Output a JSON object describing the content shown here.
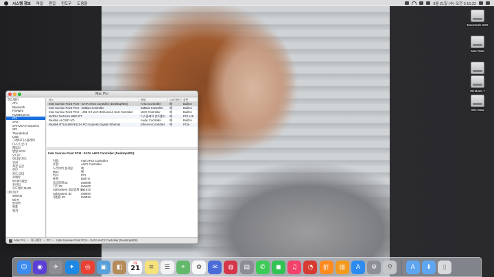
{
  "menubar": {
    "app_name": "시스템 정보",
    "menus": [
      "파일",
      "편집",
      "윈도우",
      "도움말"
    ],
    "clock": "9월 21일 (수) 오전 3:16:22"
  },
  "desktop": {
    "drives": [
      "Macintosh SSD",
      "Mac Data",
      "Mac Data",
      "Windows 7",
      "Win Data"
    ]
  },
  "window": {
    "title": "Mac Pro",
    "sidebar": [
      {
        "label": "하드웨어",
        "type": "group"
      },
      {
        "label": "ATA",
        "type": "child"
      },
      {
        "label": "Bluetooth",
        "type": "child"
      },
      {
        "label": "FireWire",
        "type": "child"
      },
      {
        "label": "NVMExpress",
        "type": "child"
      },
      {
        "label": "PCI",
        "type": "child",
        "selected": true
      },
      {
        "label": "SAS",
        "type": "child"
      },
      {
        "label": "SATA/SATA Express",
        "type": "child"
      },
      {
        "label": "SPI",
        "type": "child"
      },
      {
        "label": "Thunderbolt",
        "type": "child"
      },
      {
        "label": "USB",
        "type": "child"
      },
      {
        "label": "그래픽/디스플레이",
        "type": "child"
      },
      {
        "label": "디스크 굽기",
        "type": "child"
      },
      {
        "label": "메모리",
        "type": "child"
      },
      {
        "label": "병렬 SCSI",
        "type": "child"
      },
      {
        "label": "오디오",
        "type": "child"
      },
      {
        "label": "이더넷 카드",
        "type": "child"
      },
      {
        "label": "전원",
        "type": "child"
      },
      {
        "label": "저장 공간",
        "type": "child"
      },
      {
        "label": "진단",
        "type": "child"
      },
      {
        "label": "카드 리더",
        "type": "child"
      },
      {
        "label": "카메라",
        "type": "child"
      },
      {
        "label": "파이버 채널",
        "type": "child"
      },
      {
        "label": "프린터",
        "type": "child"
      },
      {
        "label": "하드웨어 RAID",
        "type": "child"
      },
      {
        "label": "네트워크",
        "type": "group"
      },
      {
        "label": "WWAN",
        "type": "child"
      },
      {
        "label": "Wi-Fi",
        "type": "child"
      },
      {
        "label": "방화벽",
        "type": "child"
      },
      {
        "label": "볼륨",
        "type": "child"
      },
      {
        "label": "위치",
        "type": "child"
      }
    ],
    "table": {
      "headers": [
        "카드",
        "유형",
        "드라이버 설치됨",
        "슬롯"
      ],
      "rows": [
        [
          "Intel Sunrise Point PCH - SATA AHCI Controller (Desktop/WS)",
          "AHCI Controller",
          "예",
          "Built In"
        ],
        [
          "Intel Sunrise Point PCH - SMBus Controller",
          "SMBus Controller",
          "예",
          "Built In"
        ],
        [
          "Intel Sunrise Point PCH - USB 3.0 xHCI Enhanced Host Controller",
          "xHCI Controller",
          "예",
          "Built In"
        ],
        [
          "NVIDIA GeForce 8600 GT",
          "디스플레이 컨트롤러",
          "예",
          "PCI x16"
        ],
        [
          "Realtek ALC887-VD",
          "Audio Controller",
          "예",
          "Built In"
        ],
        [
          "Realtek RTL8168H/8111H PCI Express Gigabit Ethernet",
          "Ethernet Controller",
          "예",
          "PCIe"
        ]
      ]
    },
    "detail": {
      "title": "Intel Sunrise Point PCH - SATA AHCI Controller (Desktop/WS):",
      "fields": [
        [
          "이름:",
          "Intel AHCI Controller"
        ],
        [
          "유형:",
          "AHCI Controller"
        ],
        [
          "드라이버 설치됨:",
          "예"
        ],
        [
          "MSI:",
          "예"
        ],
        [
          "버스:",
          "PCI"
        ],
        [
          "슬롯:",
          "Built In"
        ],
        [
          "공급업체 ID:",
          "0x8086"
        ],
        [
          "기기 ID:",
          "0xa102"
        ],
        [
          "Subsystem 공급업체 ID:",
          "0x1043"
        ],
        [
          "Subsystem ID:",
          "0x8694"
        ],
        [
          "개정판 ID:",
          "0x0031"
        ]
      ]
    },
    "pathbar": [
      "Mac Pro",
      "하드웨어",
      "PCI",
      "Intel Sunrise Point PCH - SATA AHCI Controller (Desktop/WS)"
    ]
  },
  "dock": {
    "calendar_day": "21",
    "calendar_month": "9월",
    "apps": [
      {
        "name": "finder",
        "color": "#3b8bf0",
        "glyph": "☺"
      },
      {
        "name": "siri",
        "color": "#5b3fd6",
        "glyph": "◉"
      },
      {
        "name": "launchpad",
        "color": "#8e8e93",
        "glyph": "✈"
      },
      {
        "name": "safari",
        "color": "#1e88e5",
        "glyph": "✦"
      },
      {
        "name": "chrome",
        "color": "#e94235",
        "glyph": "◎"
      },
      {
        "name": "preview",
        "color": "#5aa0d8",
        "glyph": "▣"
      },
      {
        "name": "contacts",
        "color": "#b58b5a",
        "glyph": "◧"
      },
      {
        "name": "calendar",
        "color": "#ffffff",
        "glyph": ""
      },
      {
        "name": "notes",
        "color": "#f6e27a",
        "glyph": "≡"
      },
      {
        "name": "reminders",
        "color": "#f2f2f2",
        "glyph": "☰"
      },
      {
        "name": "maps",
        "color": "#64b86b",
        "glyph": "⌖"
      },
      {
        "name": "photos",
        "color": "#f7f7f7",
        "glyph": "✿"
      },
      {
        "name": "messages-alt",
        "color": "#4b6bd8",
        "glyph": "✉"
      },
      {
        "name": "photo-booth",
        "color": "#d6364a",
        "glyph": "◍"
      },
      {
        "name": "image-capture",
        "color": "#8b8f95",
        "glyph": "▤"
      },
      {
        "name": "messages",
        "color": "#3ecb58",
        "glyph": "✆"
      },
      {
        "name": "facetime",
        "color": "#33c354",
        "glyph": "◼"
      },
      {
        "name": "music",
        "color": "#f2426b",
        "glyph": "♫"
      },
      {
        "name": "netease-music",
        "color": "#d73a31",
        "glyph": "◔"
      },
      {
        "name": "xiami",
        "color": "#ff8a1f",
        "glyph": "虾"
      },
      {
        "name": "ibooks",
        "color": "#f39a1e",
        "glyph": "▥"
      },
      {
        "name": "app-store",
        "color": "#2d8bf0",
        "glyph": "A"
      },
      {
        "name": "system-preferences",
        "color": "#8d9096",
        "glyph": "⚙"
      },
      {
        "name": "system-information",
        "color": "#c4c6ca",
        "glyph": "⚲"
      }
    ],
    "right": [
      {
        "name": "applications-folder",
        "color": "#5ea6ef",
        "glyph": "A"
      },
      {
        "name": "downloads-folder",
        "color": "#5ea6ef",
        "glyph": "⬇"
      },
      {
        "name": "trash",
        "color": "#d7d9dc",
        "glyph": "▯"
      }
    ]
  }
}
